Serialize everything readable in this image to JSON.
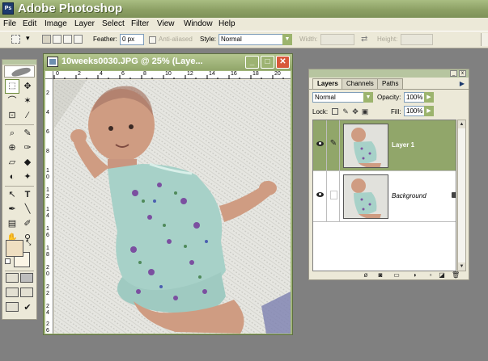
{
  "app": {
    "title": "Adobe Photoshop",
    "icon_label": "Ps"
  },
  "menu": [
    "File",
    "Edit",
    "Image",
    "Layer",
    "Select",
    "Filter",
    "View",
    "Window",
    "Help"
  ],
  "options": {
    "feather_label": "Feather:",
    "feather_value": "0 px",
    "antialiased_label": "Anti-aliased",
    "style_label": "Style:",
    "style_value": "Normal",
    "width_label": "Width:",
    "height_label": "Height:"
  },
  "tools": {
    "icons": [
      "↔",
      "✥",
      "⌒",
      "✶",
      "⊡",
      "∕",
      "⌕",
      "✎",
      "⊕",
      "✑",
      "▱",
      "◆",
      "◐",
      "✦",
      "↖",
      "T",
      "✒",
      "╲",
      "▤",
      "✐",
      "✋",
      "⚲"
    ],
    "foreground_color": "#efdfc1",
    "background_color": "#fbf5e6"
  },
  "document": {
    "title": "10weeks0030.JPG @ 25% (Laye...",
    "ruler_h": [
      "0",
      "2",
      "4",
      "6",
      "8",
      "10",
      "12",
      "14",
      "16",
      "18",
      "20"
    ],
    "ruler_v": [
      "2",
      "4",
      "6",
      "8",
      "1 0",
      "1 2",
      "1 4",
      "1 6",
      "1 8",
      "2 0",
      "2 2",
      "2 4",
      "2 6"
    ],
    "minimize_symbol": "_",
    "maximize_symbol": "□",
    "close_symbol": "✕"
  },
  "layers_panel": {
    "tabs": [
      "Layers",
      "Channels",
      "Paths"
    ],
    "blend_mode": "Normal",
    "opacity_label": "Opacity:",
    "opacity_value": "100%",
    "lock_label": "Lock:",
    "fill_label": "Fill:",
    "fill_value": "100%",
    "layers": [
      {
        "name": "Layer 1",
        "active": true
      },
      {
        "name": "Background",
        "active": false
      }
    ],
    "bottom_icons": [
      "ø",
      "◙",
      "▭",
      "◑",
      "▫",
      "◪",
      "🗑"
    ]
  },
  "colors": {
    "accent_green": "#91a66a",
    "window_chrome": "#a2b67c",
    "close_button": "#d8583a",
    "workspace": "#808080"
  }
}
